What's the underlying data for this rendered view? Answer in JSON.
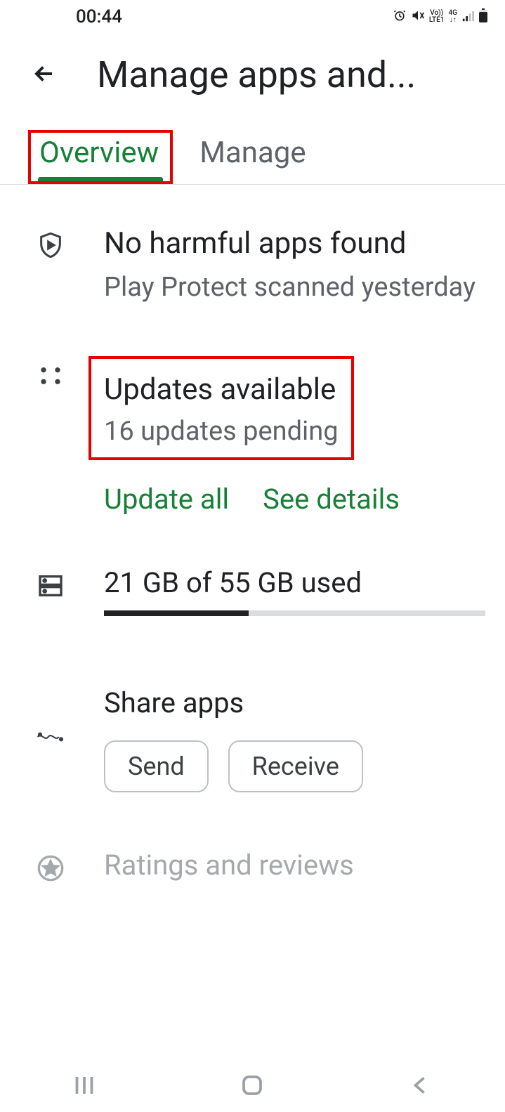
{
  "statusbar": {
    "time": "00:44",
    "net1": "Vo))",
    "net2": "LTE1",
    "net3": "4G"
  },
  "header": {
    "title": "Manage apps and..."
  },
  "tabs": {
    "overview": "Overview",
    "manage": "Manage"
  },
  "protect": {
    "title": "No harmful apps found",
    "subtitle": "Play Protect scanned yesterday"
  },
  "updates": {
    "title": "Updates available",
    "subtitle": "16 updates pending",
    "update_all": "Update all",
    "see_details": "See details"
  },
  "storage": {
    "text": "21 GB of 55 GB used",
    "percent": 38
  },
  "share": {
    "title": "Share apps",
    "send": "Send",
    "receive": "Receive"
  },
  "ratings": {
    "title": "Ratings and reviews"
  }
}
